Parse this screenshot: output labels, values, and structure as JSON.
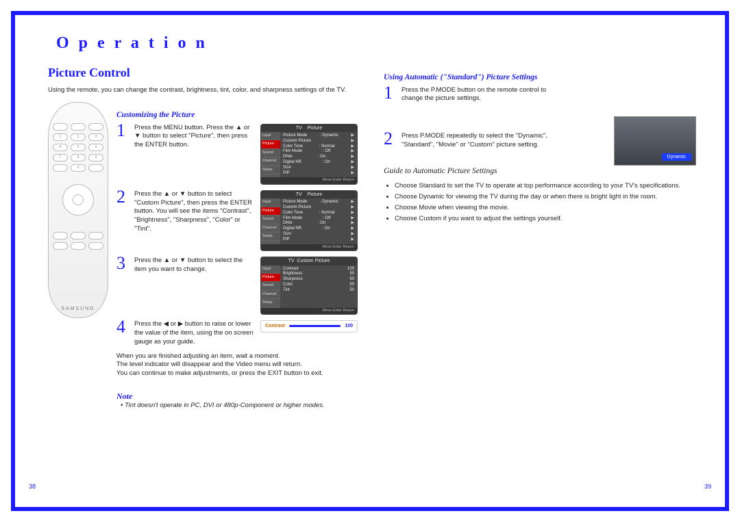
{
  "header": {
    "operation": "O p e r a t i o n"
  },
  "left": {
    "title": "Picture Control",
    "intro": "Using the remote, you can change the contrast, brightness, tint, color, and sharpness settings of the TV.",
    "sub_head": "Customizing the Picture",
    "steps": {
      "1": "Press the MENU button. Press the ▲ or ▼ button to select \"Picture\", then press the ENTER button.",
      "2": "Press the ▲ or ▼ button to select \"Custom Picture\", then press the ENTER button. You will see the items \"Contrast\", \"Brightness\", \"Sharpness\", \"Color\" or \"Tint\".",
      "3": "Press the ▲ or ▼ button to select the item you want to change.",
      "4": "Press the ◀ or ▶ button to raise or lower the value of the item, using the on screen gauge as your guide."
    },
    "closing1": "When you are finished adjusting an item, wait a moment.",
    "closing2": "The level indicator will disappear and the Video menu will return.",
    "closing3": "You can continue to make adjustments, or press the EXIT button to exit.",
    "note_head": "Note",
    "note_body": "• Tint doesn't operate in PC, DVI or 480p-Component or higher modes.",
    "osd_picture": {
      "title_tv": "TV",
      "title": "Picture",
      "side": [
        "Input",
        "Picture",
        "Sound",
        "Channel",
        "Setup"
      ],
      "rows": [
        [
          "Picture Mode",
          ": Dynamic"
        ],
        [
          "Custom Picture",
          ""
        ],
        [
          "Color Tone",
          ": Normal"
        ],
        [
          "Film Mode",
          ": Off"
        ],
        [
          "DNIe",
          ": On"
        ],
        [
          "Digital NR",
          ": On"
        ],
        [
          "Size",
          ""
        ],
        [
          "PIP",
          ""
        ]
      ],
      "foot": "Move    Enter    Return"
    },
    "osd_custom": {
      "title": "Custom Picture",
      "rows": [
        [
          "Contrast",
          "100"
        ],
        [
          "Brightness",
          "50"
        ],
        [
          "Sharpness",
          "50"
        ],
        [
          "Color",
          "50"
        ],
        [
          "Tint",
          "50"
        ]
      ]
    },
    "gauge": {
      "label": "Contrast",
      "value": "100"
    },
    "remote_brand": "SAMSUNG"
  },
  "right": {
    "sub_head": "Using Automatic (\"Standard\") Picture Settings",
    "steps": {
      "1": "Press the P.MODE button on the remote control to change the picture settings.",
      "2": "Press P.MODE repeatedly to select the \"Dynamic\", \"Standard\", \"Movie\" or \"Custom\" picture setting."
    },
    "pmode_tag": "Dynamic",
    "guide_head": "Guide to Automatic Picture Settings",
    "bullets": [
      "Choose Standard to set the TV to operate at top performance according to your TV's specifications.",
      "Choose Dynamic for viewing the TV during the day or when there is bright light in the room.",
      "Choose Movie when viewing the movie.",
      "Choose Custom if you want to adjust the settings yourself."
    ]
  },
  "page_numbers": {
    "left": "38",
    "right": "39"
  }
}
